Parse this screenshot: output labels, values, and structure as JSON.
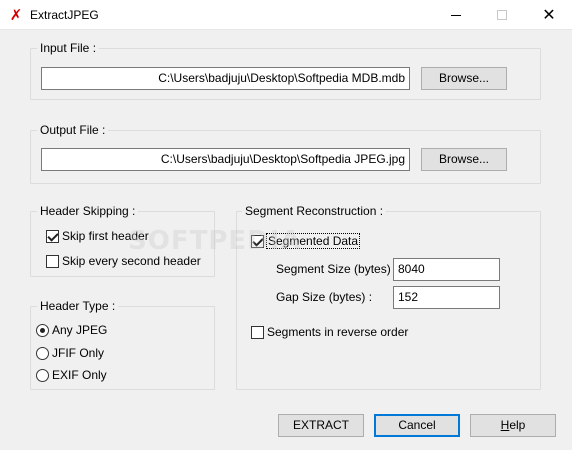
{
  "window": {
    "title": "ExtractJPEG",
    "app_icon": "red-x-icon"
  },
  "input_file": {
    "label": "Input File :",
    "path": "C:\\Users\\badjuju\\Desktop\\Softpedia MDB.mdb",
    "browse_label": "Browse..."
  },
  "output_file": {
    "label": "Output File :",
    "path": "C:\\Users\\badjuju\\Desktop\\Softpedia JPEG.jpg",
    "browse_label": "Browse..."
  },
  "header_skipping": {
    "label": "Header Skipping :",
    "skip_first": {
      "label": "Skip first header",
      "checked": true
    },
    "skip_every_second": {
      "label": "Skip every second header",
      "checked": false
    }
  },
  "header_type": {
    "label": "Header Type :",
    "options": [
      {
        "label": "Any JPEG",
        "selected": true
      },
      {
        "label": "JFIF Only",
        "selected": false
      },
      {
        "label": "EXIF Only",
        "selected": false
      }
    ]
  },
  "segment_reconstruction": {
    "label": "Segment Reconstruction :",
    "segmented_data": {
      "label": "Segmented Data",
      "checked": true
    },
    "segment_size": {
      "label": "Segment Size (bytes)",
      "value": "8040"
    },
    "gap_size": {
      "label": "Gap Size (bytes) :",
      "value": "152"
    },
    "reverse_order": {
      "label": "Segments in reverse order",
      "checked": false
    }
  },
  "buttons": {
    "extract": "EXTRACT",
    "cancel": "Cancel",
    "help_prefix": "",
    "help_underlined": "H",
    "help_rest": "elp"
  },
  "watermark": "SOFTPEDIA"
}
